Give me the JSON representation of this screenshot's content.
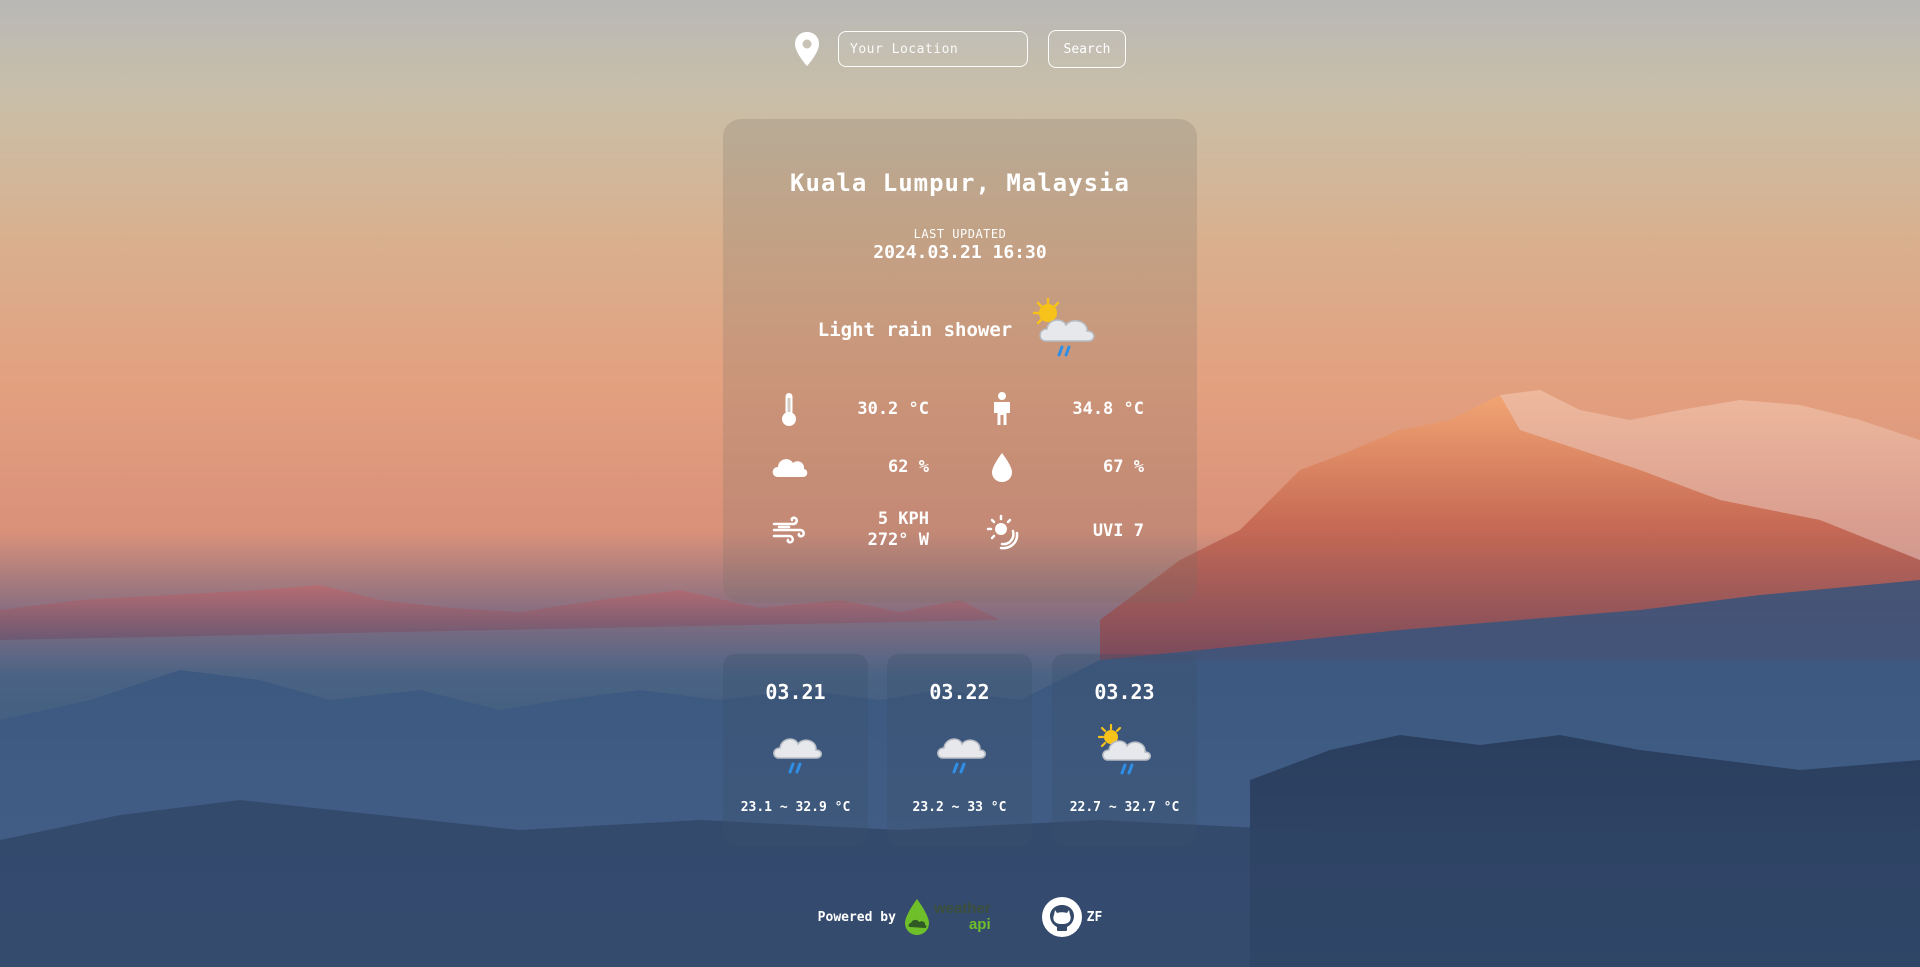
{
  "search": {
    "placeholder": "Your Location",
    "button_label": "Search"
  },
  "current": {
    "location": "Kuala Lumpur, Malaysia",
    "last_updated_label": "LAST UPDATED",
    "last_updated": "2024.03.21 16:30",
    "condition": "Light rain shower",
    "temperature": "30.2 °C",
    "feels_like": "34.8 °C",
    "cloud": "62 %",
    "humidity": "67 %",
    "wind_speed": "5 KPH",
    "wind_dir": "272° W",
    "uv": "UVI 7"
  },
  "forecast": [
    {
      "date": "03.21",
      "range": "23.1 ~ 32.9 °C",
      "icon": "rain-cloud-icon"
    },
    {
      "date": "03.22",
      "range": "23.2 ~ 33 °C",
      "icon": "rain-cloud-icon"
    },
    {
      "date": "03.23",
      "range": "22.7 ~ 32.7 °C",
      "icon": "sun-rain-cloud-icon"
    }
  ],
  "footer": {
    "powered_by": "Powered by",
    "logo_word1": "weather",
    "logo_word2": "api",
    "github_user": "ZF"
  },
  "colors": {
    "text": "#ffffff",
    "logo_green": "#6fbf2a",
    "rain_blue": "#2f8fe6",
    "sun_yellow": "#f7c21a"
  }
}
